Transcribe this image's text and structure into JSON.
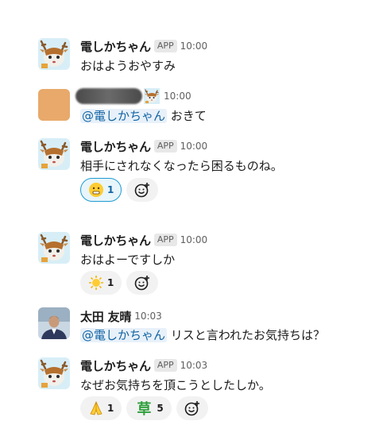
{
  "messages": [
    {
      "author": "電しかちゃん",
      "app_badge": "APP",
      "time": "10:00",
      "text": "おはようおやすみ"
    },
    {
      "author": "",
      "time": "10:00",
      "mention": "@電しかちゃん",
      "text": " おきて"
    },
    {
      "author": "電しかちゃん",
      "app_badge": "APP",
      "time": "10:00",
      "text": "相手にされなくなったら困るものね。",
      "reactions": [
        {
          "emoji": "grimace-face",
          "count": "1"
        }
      ]
    },
    {
      "author": "電しかちゃん",
      "app_badge": "APP",
      "time": "10:00",
      "text": "おはよーですしか",
      "reactions": [
        {
          "emoji": "sun",
          "count": "1"
        }
      ]
    },
    {
      "author": "太田 友晴",
      "time": "10:03",
      "mention": "@電しかちゃん",
      "text": " リスと言われたお気持ちは？"
    },
    {
      "author": "電しかちゃん",
      "app_badge": "APP",
      "time": "10:03",
      "text": "なぜお気持ちを頂こうとしたしか。",
      "reactions": [
        {
          "emoji": "pray",
          "count": "1"
        },
        {
          "emoji": "草",
          "count": "5"
        }
      ]
    }
  ],
  "colors": {
    "mention_bg": "#e8f1fa",
    "mention_fg": "#1264a3",
    "active_reaction_border": "#1d9bd1",
    "grass": "#2e9e3a"
  }
}
